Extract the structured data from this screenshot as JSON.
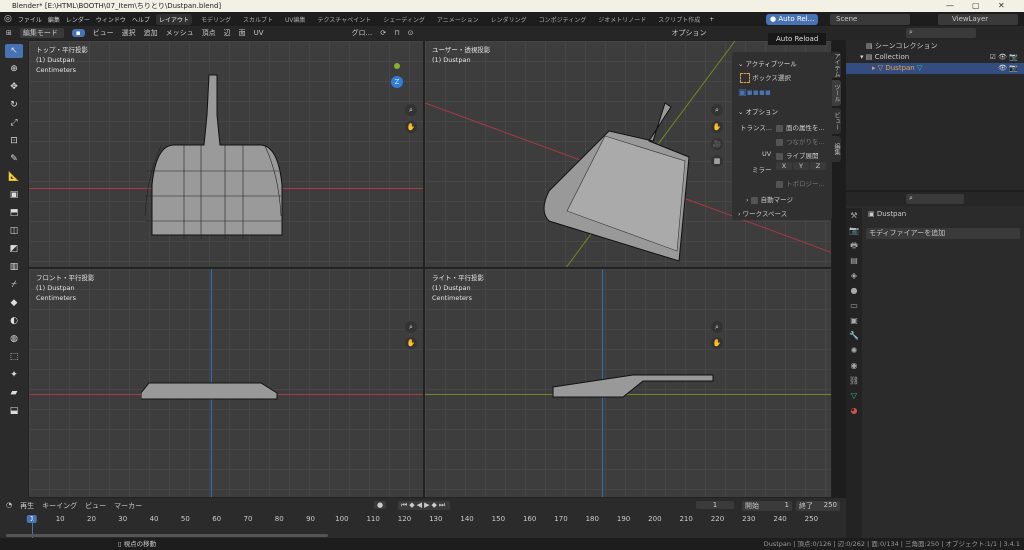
{
  "window": {
    "title": "Blender* [E:\\HTML\\BOOTH\\07_Item\\ちりとり\\Dustpan.blend]"
  },
  "menu": [
    "ファイル",
    "編集",
    "レンダー",
    "ウィンドウ",
    "ヘルプ"
  ],
  "workspaces": [
    "レイアウト",
    "モデリング",
    "スカルプト",
    "UV編集",
    "テクスチャペイント",
    "シェーディング",
    "アニメーション",
    "レンダリング",
    "コンポジティング",
    "ジオメトリノード",
    "スクリプト作成",
    "+"
  ],
  "auto_reload": "Auto Rel...",
  "auto_reload_tooltip": "Auto Reload",
  "scene": "Scene",
  "view_layer": "ViewLayer",
  "header": {
    "mode": "編集モード",
    "menus": [
      "ビュー",
      "選択",
      "追加",
      "メッシュ",
      "頂点",
      "辺",
      "面",
      "UV"
    ],
    "transform": "グロ...",
    "options": "オプション"
  },
  "viewports": [
    {
      "title": "トップ・平行投影",
      "object": "(1) Dustpan",
      "units": "Centimeters"
    },
    {
      "title": "ユーザー・透視投影",
      "object": "(1) Dustpan"
    },
    {
      "title": "フロント・平行投影",
      "object": "(1) Dustpan",
      "units": "Centimeters"
    },
    {
      "title": "ライト・平行投影",
      "object": "(1) Dustpan",
      "units": "Centimeters"
    }
  ],
  "npanel": {
    "active_tool": "アクティブツール",
    "box_select": "ボックス選択",
    "options": "オプション",
    "transform": "トランス...",
    "face_attr": "面の属性を...",
    "connected": "つながりを...",
    "uv": "UV",
    "live_unwrap": "ライブ展開",
    "mirror": "ミラー",
    "x": "X",
    "y": "Y",
    "z": "Z",
    "topology": "トポロジー...",
    "auto_merge": "自動マージ",
    "workspace": "ワークスペース",
    "tabs": [
      "アイテム",
      "ツール",
      "ビュー",
      "編集"
    ]
  },
  "outliner": {
    "scene_collection": "シーンコレクション",
    "collection": "Collection",
    "object": "Dustpan"
  },
  "properties": {
    "object": "Dustpan",
    "add_modifier": "モディファイアーを追加"
  },
  "timeline": {
    "menus": [
      "再生",
      "キーイング",
      "ビュー",
      "マーカー"
    ],
    "current_frame": "1",
    "start_label": "開始",
    "start": "1",
    "end_label": "終了",
    "end": "250",
    "ticks": [
      "1",
      "10",
      "20",
      "30",
      "40",
      "50",
      "60",
      "70",
      "80",
      "90",
      "100",
      "110",
      "120",
      "130",
      "140",
      "150",
      "160",
      "170",
      "180",
      "190",
      "200",
      "210",
      "220",
      "230",
      "240",
      "250"
    ]
  },
  "status": {
    "hint": "視点の移動",
    "stats": "Dustpan | 頂点:0/126 | 辺:0/262 | 面:0/134 | 三角面:250 | オブジェクト:1/1 | 3.4.1"
  },
  "colors": {
    "accent": "#4772b3",
    "xaxis": "#c8424b",
    "yaxis": "#8bb02a",
    "zaxis": "#2f7fd8"
  }
}
